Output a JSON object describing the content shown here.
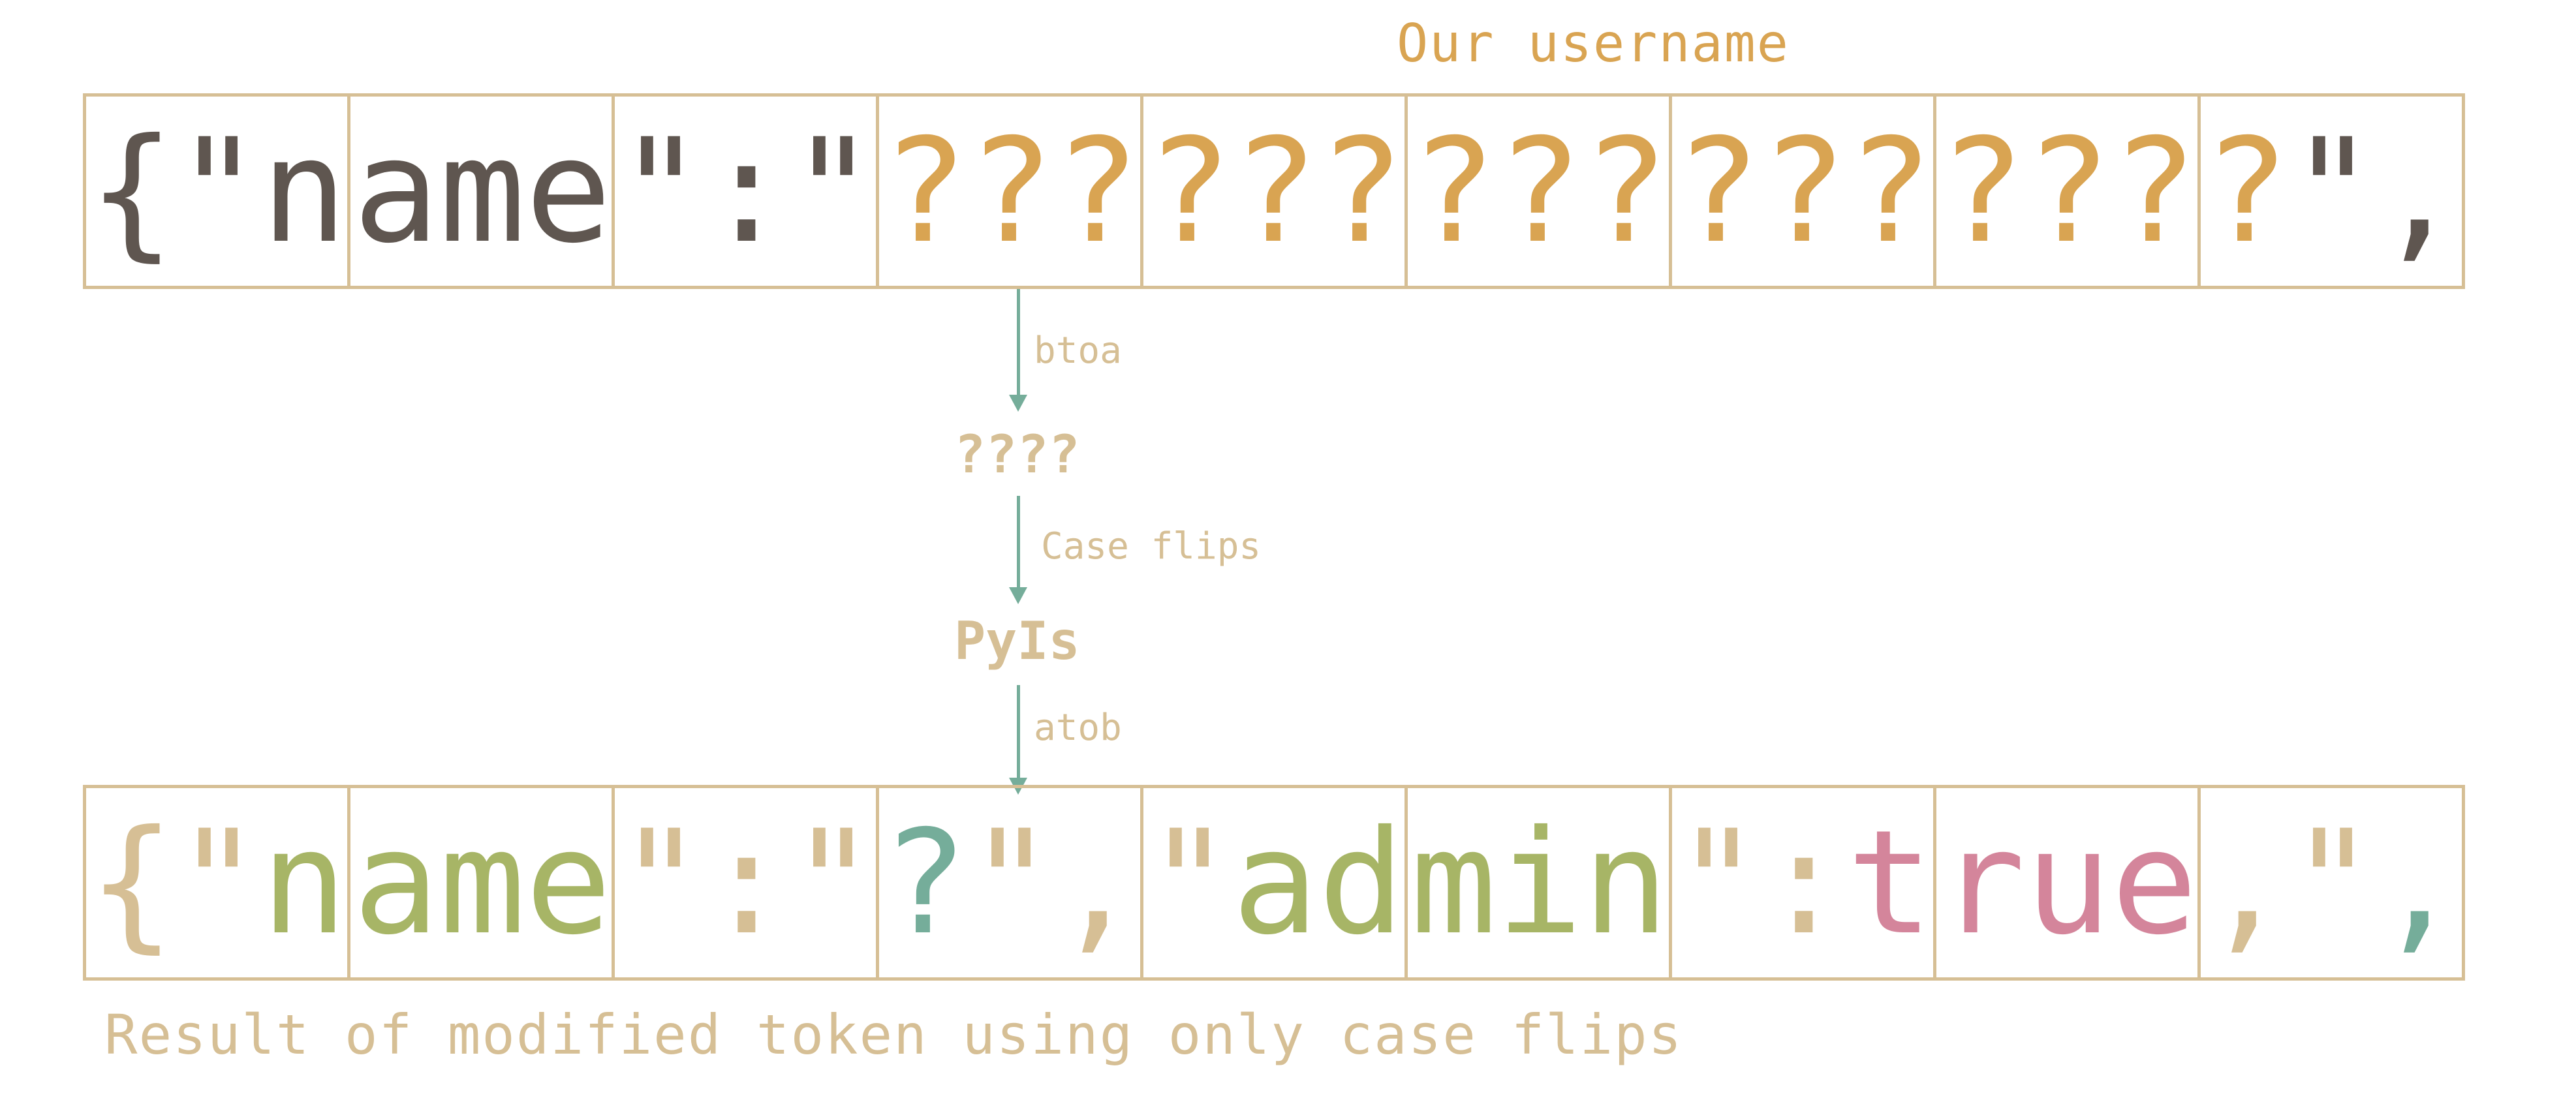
{
  "title": "Our username",
  "top_row": [
    [
      {
        "t": "{",
        "c": "dark"
      },
      {
        "t": "\"",
        "c": "dark"
      },
      {
        "t": "n",
        "c": "dark"
      }
    ],
    [
      {
        "t": "a",
        "c": "dark"
      },
      {
        "t": "m",
        "c": "dark"
      },
      {
        "t": "e",
        "c": "dark"
      }
    ],
    [
      {
        "t": "\"",
        "c": "dark"
      },
      {
        "t": ":",
        "c": "dark"
      },
      {
        "t": "\"",
        "c": "dark"
      }
    ],
    [
      {
        "t": "?",
        "c": "orange"
      },
      {
        "t": "?",
        "c": "orange"
      },
      {
        "t": "?",
        "c": "orange"
      }
    ],
    [
      {
        "t": "?",
        "c": "orange"
      },
      {
        "t": "?",
        "c": "orange"
      },
      {
        "t": "?",
        "c": "orange"
      }
    ],
    [
      {
        "t": "?",
        "c": "orange"
      },
      {
        "t": "?",
        "c": "orange"
      },
      {
        "t": "?",
        "c": "orange"
      }
    ],
    [
      {
        "t": "?",
        "c": "orange"
      },
      {
        "t": "?",
        "c": "orange"
      },
      {
        "t": "?",
        "c": "orange"
      }
    ],
    [
      {
        "t": "?",
        "c": "orange"
      },
      {
        "t": "?",
        "c": "orange"
      },
      {
        "t": "?",
        "c": "orange"
      }
    ],
    [
      {
        "t": "?",
        "c": "orange"
      },
      {
        "t": "\"",
        "c": "dark"
      },
      {
        "t": ",",
        "c": "dark"
      }
    ]
  ],
  "step1_label": "btoa",
  "step1_result": "????",
  "step2_label": "Case flips",
  "step2_result": "PyIs",
  "step3_label": "atob",
  "bottom_row": [
    [
      {
        "t": "{",
        "c": "tan"
      },
      {
        "t": "\"",
        "c": "tan"
      },
      {
        "t": "n",
        "c": "green"
      }
    ],
    [
      {
        "t": "a",
        "c": "green"
      },
      {
        "t": "m",
        "c": "green"
      },
      {
        "t": "e",
        "c": "green"
      }
    ],
    [
      {
        "t": "\"",
        "c": "tan"
      },
      {
        "t": ":",
        "c": "tan"
      },
      {
        "t": "\"",
        "c": "tan"
      }
    ],
    [
      {
        "t": "?",
        "c": "teal"
      },
      {
        "t": "\"",
        "c": "tan"
      },
      {
        "t": ",",
        "c": "tan"
      }
    ],
    [
      {
        "t": "\"",
        "c": "tan"
      },
      {
        "t": "a",
        "c": "green"
      },
      {
        "t": "d",
        "c": "green"
      }
    ],
    [
      {
        "t": "m",
        "c": "green"
      },
      {
        "t": "i",
        "c": "green"
      },
      {
        "t": "n",
        "c": "green"
      }
    ],
    [
      {
        "t": "\"",
        "c": "tan"
      },
      {
        "t": ":",
        "c": "tan"
      },
      {
        "t": "t",
        "c": "pink"
      }
    ],
    [
      {
        "t": "r",
        "c": "pink"
      },
      {
        "t": "u",
        "c": "pink"
      },
      {
        "t": "e",
        "c": "pink"
      }
    ],
    [
      {
        "t": ",",
        "c": "tan"
      },
      {
        "t": "\"",
        "c": "tan"
      },
      {
        "t": ",",
        "c": "teal"
      }
    ]
  ],
  "caption": "Result of modified token using only case flips",
  "colors": {
    "dark": "#5f5650",
    "orange": "#d9a452",
    "tan": "#d6bf95",
    "green": "#a7b566",
    "teal": "#75ad9a",
    "pink": "#d4859b",
    "border": "#d6bf95",
    "arrow": "#75ad9a"
  }
}
